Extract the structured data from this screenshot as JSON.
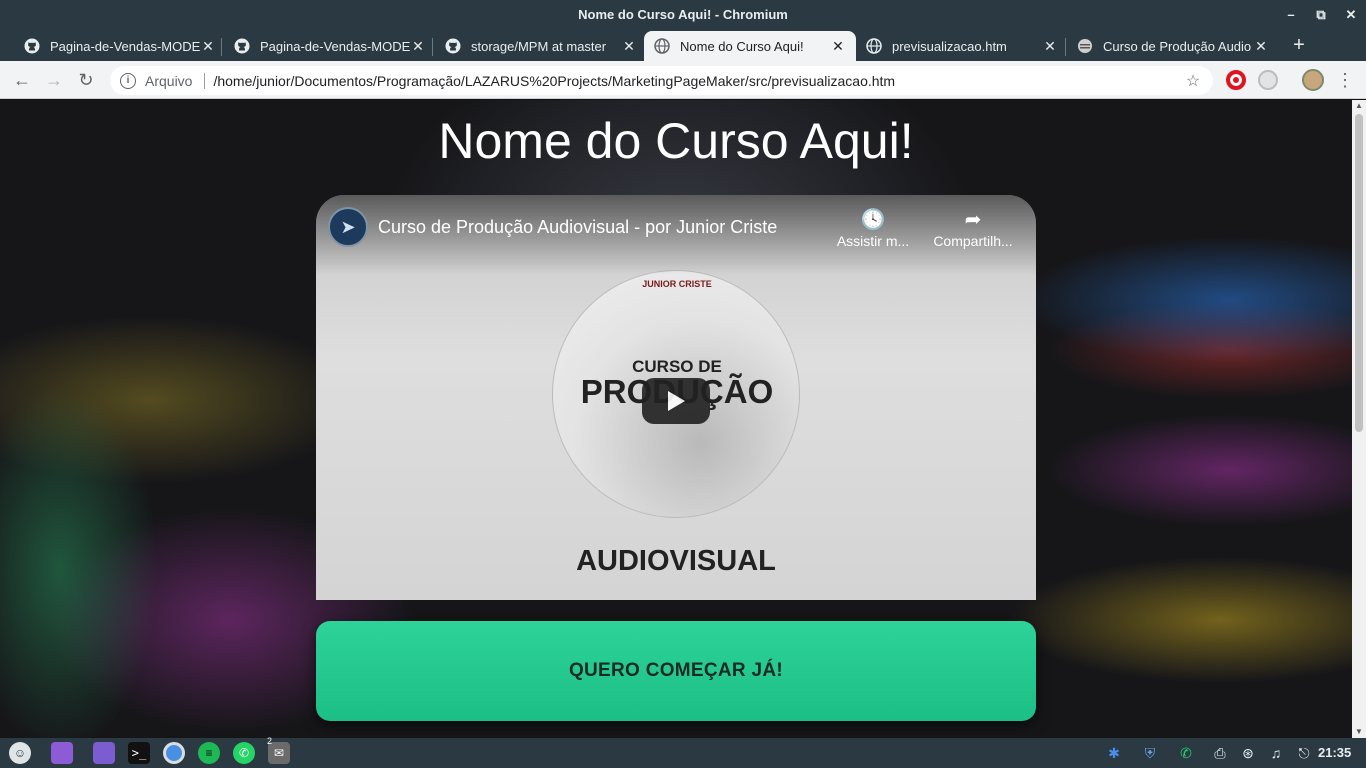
{
  "window": {
    "title": "Nome do Curso Aqui! - Chromium",
    "controls": [
      "minimize",
      "maximize",
      "close"
    ]
  },
  "tabs": [
    {
      "title": "Pagina-de-Vendas-MODE",
      "icon": "github-icon",
      "active": false
    },
    {
      "title": "Pagina-de-Vendas-MODE",
      "icon": "github-icon",
      "active": false
    },
    {
      "title": "storage/MPM at master",
      "icon": "github-icon",
      "active": false
    },
    {
      "title": "Nome do Curso Aqui!",
      "icon": "globe-icon",
      "active": true
    },
    {
      "title": "previsualizacao.htm",
      "icon": "globe-icon",
      "active": false
    },
    {
      "title": "Curso de Produção Audio",
      "icon": "course-icon",
      "active": false
    }
  ],
  "toolbar": {
    "scheme": "Arquivo",
    "url": "/home/junior/Documentos/Programação/LAZARUS%20Projects/MarketingPageMaker/src/previsualizacao.htm"
  },
  "page": {
    "title": "Nome do Curso Aqui!",
    "video": {
      "title": "Curso de Produção Audiovisual - por Junior Criste",
      "watch_later": "Assistir m...",
      "share": "Compartilh...",
      "cover_author": "JUNIOR CRISTE",
      "cover_line1": "CURSO DE",
      "cover_line2": "PRODUÇÃO",
      "cover_line3": "AUDIOVISUAL"
    },
    "cta_label": "QUERO COMEÇAR JÁ!",
    "cta_color": "#22c98f"
  },
  "taskbar": {
    "badge_count": "2",
    "clock": "21:35"
  }
}
